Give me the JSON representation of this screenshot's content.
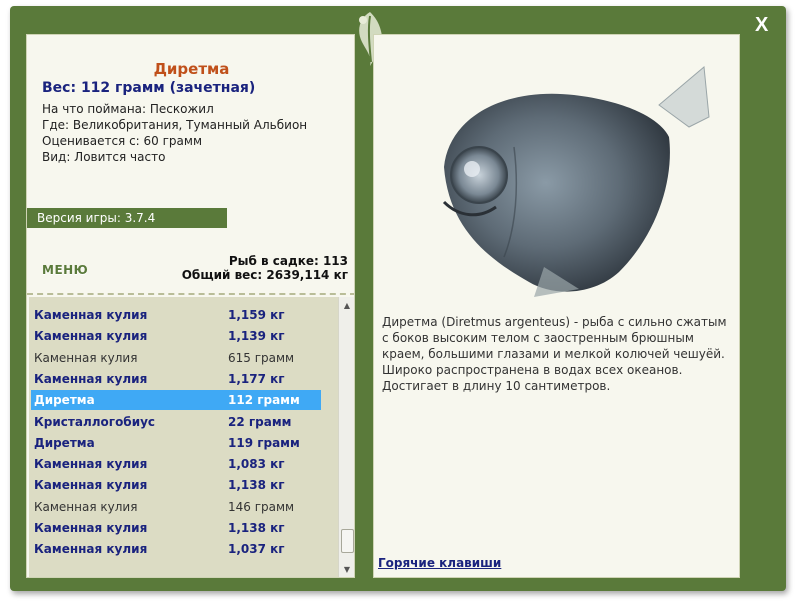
{
  "fish": {
    "title": "Диретма",
    "weight": "Вес: 112 грамм (зачетная)",
    "info": [
      "На что поймана: Пескожил",
      "Где: Великобритания, Туманный Альбион",
      "Оценивается с: 60 грамм",
      "Вид: Ловится часто"
    ],
    "description": "Диретма (Diretmus argenteus) - рыба с сильно сжатым с боков высоким телом с заостренным брюшным краем, большими глазами и мелкой колючей чешуёй. Широко распространена в водах всех океанов. Достигает в длину 10 сантиметров."
  },
  "version": "Версия игры: 3.7.4",
  "menu_label": "МЕНЮ",
  "stats": {
    "count": "Рыб в садке: 113",
    "total_weight": "Общий вес: 2639,114 кг"
  },
  "catch_list": [
    {
      "name": "Каменная кулия",
      "weight": "1,159 кг",
      "style": "bold"
    },
    {
      "name": "Каменная кулия",
      "weight": "1,139 кг",
      "style": "bold"
    },
    {
      "name": "Каменная кулия",
      "weight": "615 грамм",
      "style": "norm"
    },
    {
      "name": "Каменная кулия",
      "weight": "1,177 кг",
      "style": "bold"
    },
    {
      "name": "Диретма",
      "weight": "112 грамм",
      "style": "sel"
    },
    {
      "name": "Кристаллогобиус",
      "weight": "22 грамм",
      "style": "bold"
    },
    {
      "name": "Диретма",
      "weight": "119 грамм",
      "style": "bold"
    },
    {
      "name": "Каменная кулия",
      "weight": "1,083 кг",
      "style": "bold"
    },
    {
      "name": "Каменная кулия",
      "weight": "1,138 кг",
      "style": "bold"
    },
    {
      "name": "Каменная кулия",
      "weight": "146 грамм",
      "style": "norm"
    },
    {
      "name": "Каменная кулия",
      "weight": "1,138 кг",
      "style": "bold"
    },
    {
      "name": "Каменная кулия",
      "weight": "1,037 кг",
      "style": "bold"
    }
  ],
  "hotkeys_label": "Горячие клавиши",
  "close_label": "X",
  "colors": {
    "frame": "#5a7a3a",
    "panel": "#f7f7ee",
    "title": "#c0501a",
    "accent_text": "#1a237e",
    "selection": "#3fa9f5"
  }
}
